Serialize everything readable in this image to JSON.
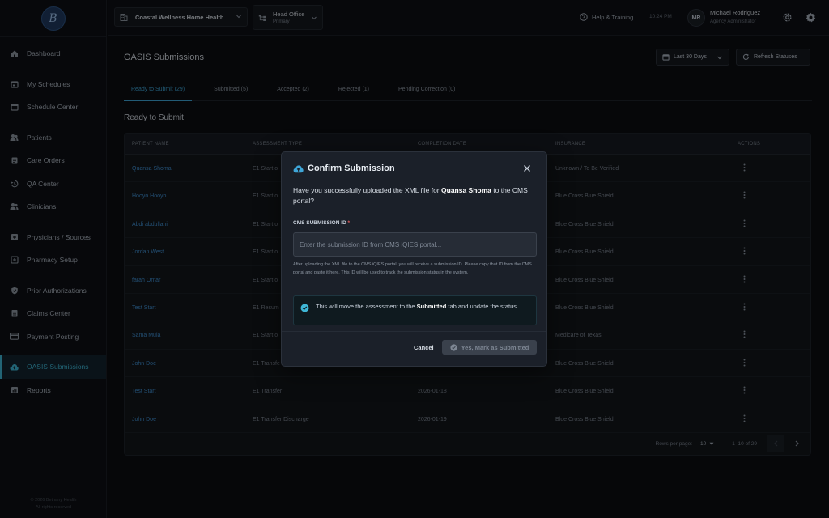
{
  "sidebar": {
    "logo_text": "B",
    "items": [
      {
        "label": "Dashboard",
        "icon": "home-icon"
      },
      {
        "label": "My Schedules",
        "icon": "calendar-icon"
      },
      {
        "label": "Schedule Center",
        "icon": "calendar-icon"
      },
      {
        "label": "Patients",
        "icon": "users-icon"
      },
      {
        "label": "Care Orders",
        "icon": "clipboard-icon"
      },
      {
        "label": "QA Center",
        "icon": "history-icon"
      },
      {
        "label": "Clinicians",
        "icon": "users-icon"
      },
      {
        "label": "Physicians / Sources",
        "icon": "plus-square-icon"
      },
      {
        "label": "Pharmacy Setup",
        "icon": "pharmacy-icon"
      },
      {
        "label": "Prior Authorizations",
        "icon": "shield-check-icon"
      },
      {
        "label": "Claims Center",
        "icon": "document-icon"
      },
      {
        "label": "Payment Posting",
        "icon": "credit-card-icon"
      },
      {
        "label": "OASIS Submissions",
        "icon": "cloud-upload-icon"
      },
      {
        "label": "Reports",
        "icon": "chart-icon"
      }
    ],
    "footer_line1": "© 2026 Bethany Health",
    "footer_line2": "All rights reserved"
  },
  "topbar": {
    "agency": "Coastal Wellness Home Health",
    "office_name": "Head Office",
    "office_sub": "Primary",
    "help": "Help & Training",
    "time": "10:24 PM",
    "user_initials": "MR",
    "user_name": "Michael Rodriguez",
    "user_role": "Agency Administrator"
  },
  "page": {
    "title": "OASIS Submissions",
    "date_filter": "Last 30 Days",
    "refresh": "Refresh Statuses",
    "tabs": [
      "Ready to Submit (29)",
      "Submitted (5)",
      "Accepted (2)",
      "Rejected (1)",
      "Pending Correction (0)"
    ],
    "section_title": "Ready to Submit"
  },
  "table": {
    "headers": {
      "name": "PATIENT NAME",
      "type": "ASSESSMENT TYPE",
      "date": "COMPLETION DATE",
      "insurance": "INSURANCE",
      "actions": "ACTIONS"
    },
    "rows": [
      {
        "name": "Quansa Shoma",
        "type": "E1 Start o",
        "date": "",
        "insurance": "Unknown / To Be Verified"
      },
      {
        "name": "Hooyo Hooyo",
        "type": "E1 Start o",
        "date": "",
        "insurance": "Blue Cross Blue Shield"
      },
      {
        "name": "Abdi abdullahi",
        "type": "E1 Start o",
        "date": "",
        "insurance": "Blue Cross Blue Shield"
      },
      {
        "name": "Jordan West",
        "type": "E1 Start o",
        "date": "",
        "insurance": "Blue Cross Blue Shield"
      },
      {
        "name": "farah Omar",
        "type": "E1 Start o",
        "date": "",
        "insurance": "Blue Cross Blue Shield"
      },
      {
        "name": "Test Start",
        "type": "E1 Resum",
        "date": "",
        "insurance": "Blue Cross Blue Shield"
      },
      {
        "name": "Sama Mula",
        "type": "E1 Start o",
        "date": "",
        "insurance": "Medicare of Texas"
      },
      {
        "name": "John Doe",
        "type": "E1 Transfe",
        "date": "",
        "insurance": "Blue Cross Blue Shield"
      },
      {
        "name": "Test Start",
        "type": "E1 Transfer",
        "date": "2026-01-18",
        "insurance": "Blue Cross Blue Shield"
      },
      {
        "name": "John Doe",
        "type": "E1 Transfer Discharge",
        "date": "2026-01-19",
        "insurance": "Blue Cross Blue Shield"
      }
    ],
    "rows_per_page_label": "Rows per page:",
    "rows_per_page": "10",
    "range": "1–10 of 29"
  },
  "modal": {
    "title": "Confirm Submission",
    "q_pre": "Have you successfully uploaded the XML file for ",
    "q_name": "Quansa Shoma",
    "q_post": " to the CMS portal?",
    "field_label": "CMS SUBMISSION ID",
    "required": "*",
    "placeholder": "Enter the submission ID from CMS iQIES portal...",
    "help": "After uploading the XML file to the CMS iQIES portal, you will receive a submission ID. Please copy that ID from the CMS portal and paste it here. This ID will be used to track the submission status in the system.",
    "info_pre": "This will move the assessment to the ",
    "info_bold": "Submitted",
    "info_post": " tab and update the status.",
    "cancel": "Cancel",
    "confirm": "Yes, Mark as Submitted"
  },
  "colors": {
    "accent": "#3fa6d8",
    "link": "#3f8fd0",
    "active_nav": "#3fb7d6",
    "required": "#e05a5a"
  }
}
